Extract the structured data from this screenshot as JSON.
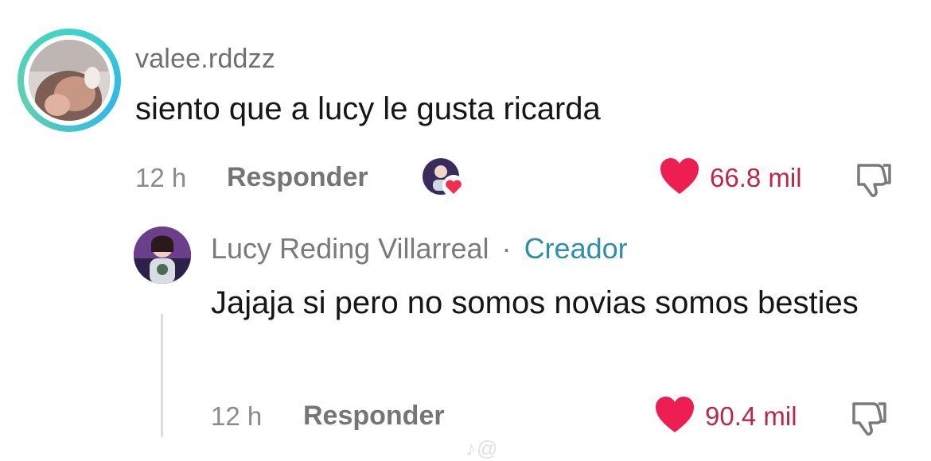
{
  "comment": {
    "username": "valee.rddzz",
    "text": "siento que a lucy le gusta ricarda",
    "time": "12 h",
    "reply_label": "Responder",
    "likes": "66.8 mil",
    "icons": {
      "avatar": "user-avatar",
      "creator_liked": "creator-liked-badge-icon",
      "like": "heart-icon",
      "dislike": "thumbs-down-icon"
    }
  },
  "reply": {
    "author": "Lucy Reding Villarreal",
    "separator": "·",
    "badge": "Creador",
    "text": "Jajaja si pero no somos novias somos besties",
    "time": "12 h",
    "reply_label": "Responder",
    "likes": "90.4 mil",
    "icons": {
      "avatar": "user-avatar",
      "like": "heart-icon",
      "dislike": "thumbs-down-icon"
    }
  },
  "watermark": "♪@"
}
